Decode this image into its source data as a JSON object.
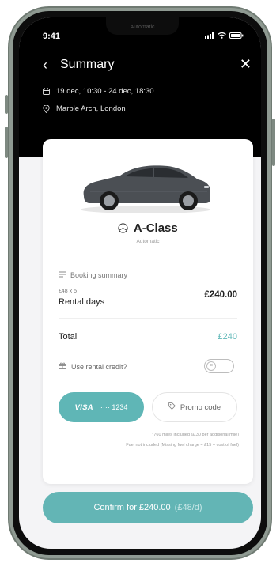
{
  "status_bar": {
    "time": "9:41",
    "notch_label": "Automatic"
  },
  "header": {
    "title": "Summary",
    "dates": "19 dec, 10:30 - 24 dec, 18:30",
    "location": "Marble Arch, London"
  },
  "car": {
    "model": "A-Class",
    "transmission": "Automatic"
  },
  "booking": {
    "section_label": "Booking summary",
    "rate_line": "£48 x 5",
    "rental_days_label": "Rental days",
    "rental_days_price": "£240.00",
    "total_label": "Total",
    "total_value": "£240"
  },
  "credit": {
    "label": "Use rental credit?",
    "enabled": false
  },
  "payment": {
    "card_brand": "VISA",
    "card_masked": "···· 1234",
    "promo_label": "Promo code"
  },
  "fine_print": {
    "miles": "*760 miles included (£.30 per additional mile)",
    "fuel": "Fuel not included (Missing fuel charge = £15 + cost of fuel)"
  },
  "confirm": {
    "label": "Confirm for £240.00",
    "rate": "(£48/d)"
  },
  "colors": {
    "accent": "#5fb6b6",
    "header_bg": "#000000",
    "card_bg": "#ffffff"
  }
}
